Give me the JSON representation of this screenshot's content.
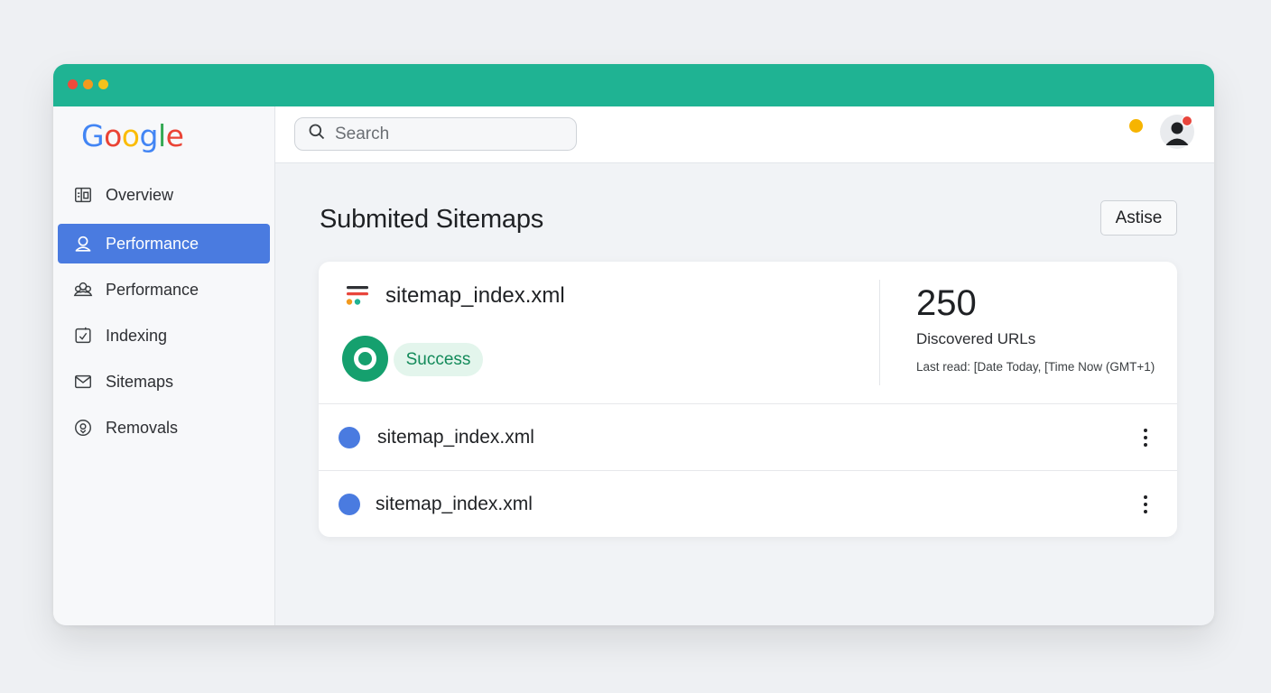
{
  "window": {
    "controls": [
      "close",
      "minimize",
      "maximize"
    ]
  },
  "sidebar": {
    "logo": [
      "G",
      "o",
      "o",
      "g",
      "l",
      "e"
    ],
    "items": [
      {
        "label": "Overview",
        "icon": "dashboard-icon",
        "active": false
      },
      {
        "label": "Performance",
        "icon": "user-icon",
        "active": true
      },
      {
        "label": "Performance",
        "icon": "people-icon",
        "active": false
      },
      {
        "label": "Indexing",
        "icon": "indexing-icon",
        "active": false
      },
      {
        "label": "Sitemaps",
        "icon": "mail-icon",
        "active": false
      },
      {
        "label": "Removals",
        "icon": "removals-icon",
        "active": false
      }
    ]
  },
  "topbar": {
    "search_placeholder": "Search",
    "notification_color": "#f6b400"
  },
  "main": {
    "title": "Submited Sitemaps",
    "action_button": "Astise",
    "summary": {
      "file_name": "sitemap_index.xml",
      "status": "Success",
      "count": "250",
      "count_label": "Discovered URLs",
      "last_read": "Last read: [Date Today, [Time Now (GMT+1)"
    },
    "rows": [
      {
        "name": "sitemap_index.xml"
      },
      {
        "name": "sitemap_index.xml"
      }
    ]
  },
  "colors": {
    "titlebar": "#1fb393",
    "active_nav": "#4a7be0",
    "success": "#15a06e"
  }
}
